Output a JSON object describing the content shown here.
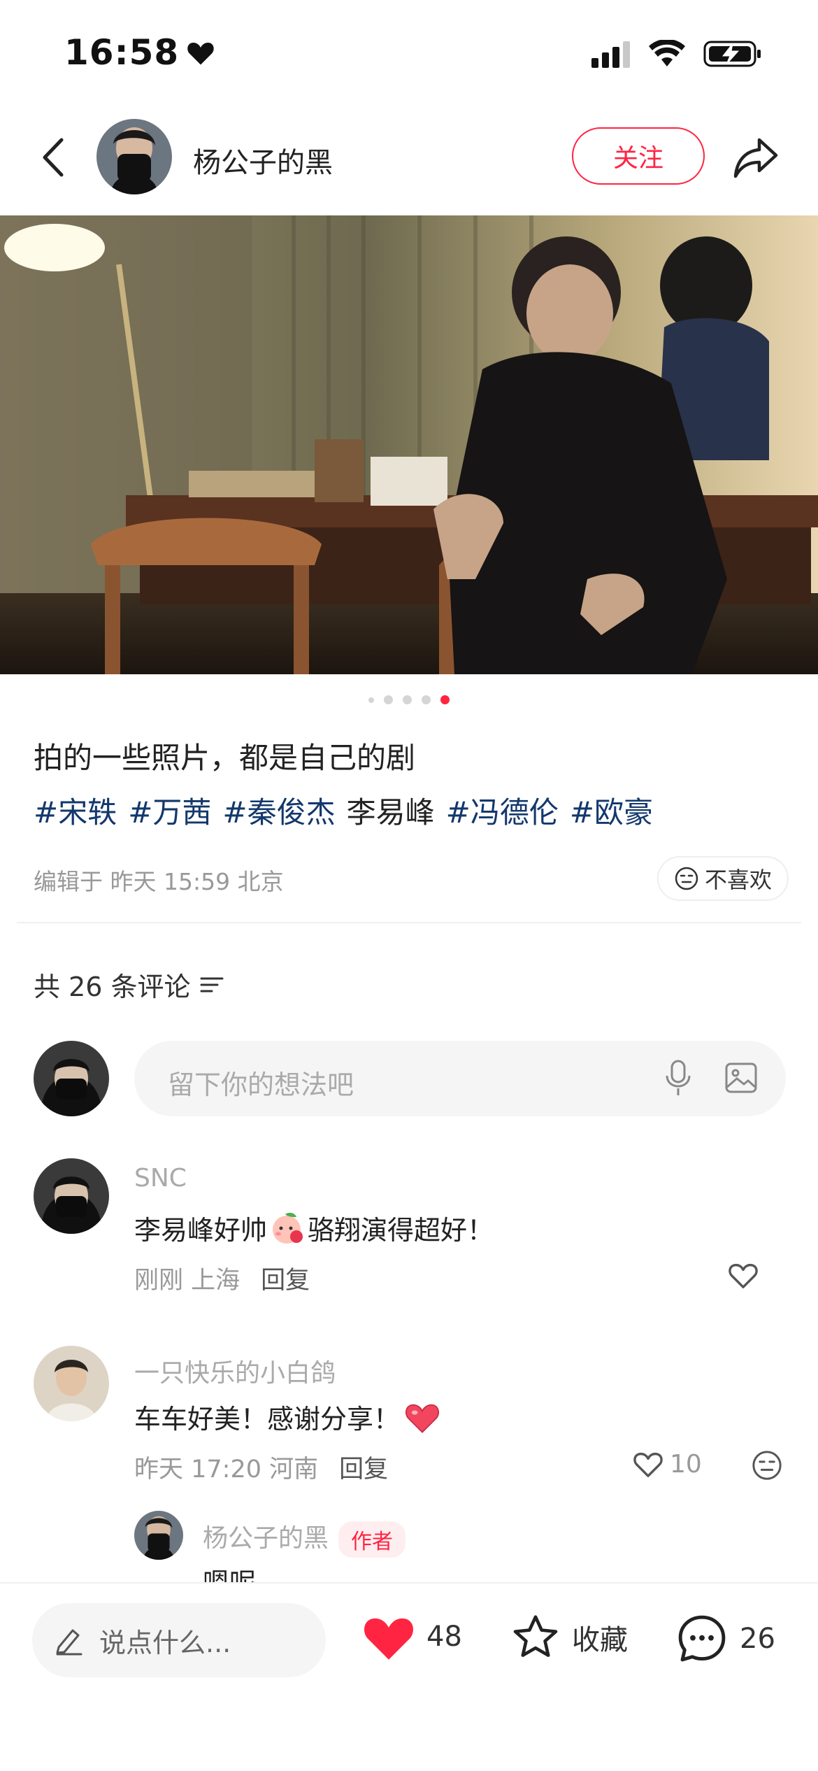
{
  "status_bar": {
    "time": "16:58",
    "icons": [
      "heart-icon",
      "signal-icon",
      "wifi-icon",
      "battery-charging-icon"
    ]
  },
  "header": {
    "author_name": "杨公子的黑",
    "follow_label": "关注"
  },
  "photo": {
    "pager": {
      "count": 5,
      "active_index": 4
    }
  },
  "post": {
    "description": "拍的一些照片，都是自己的剧",
    "tags": [
      "#宋轶",
      "#万茜",
      "#秦俊杰"
    ],
    "plain_tag": "李易峰",
    "tags_after": [
      "#冯德伦",
      "#欧豪"
    ],
    "edited": "编辑于 昨天 15:59 北京",
    "dislike_label": "不喜欢"
  },
  "comments_section": {
    "count_label": "共 26 条评论",
    "input_placeholder": "留下你的想法吧"
  },
  "comments": [
    {
      "name": "SNC",
      "text_before": "李易峰好帅",
      "text_after": "骆翔演得超好！",
      "time_place": "刚刚 上海",
      "reply": "回复"
    },
    {
      "name": "一只快乐的小白鸽",
      "text": "车车好美！感谢分享！",
      "time_place": "昨天 17:20 河南",
      "reply": "回复",
      "likes": "10"
    }
  ],
  "sub_reply": {
    "name": "杨公子的黑",
    "author_tag": "作者",
    "text": "嗯呢"
  },
  "bottom_bar": {
    "say_placeholder": "说点什么...",
    "likes": "48",
    "collect_label": "收藏",
    "comments": "26"
  },
  "colors": {
    "accent": "#ff2442",
    "tag_blue": "#13386c"
  }
}
